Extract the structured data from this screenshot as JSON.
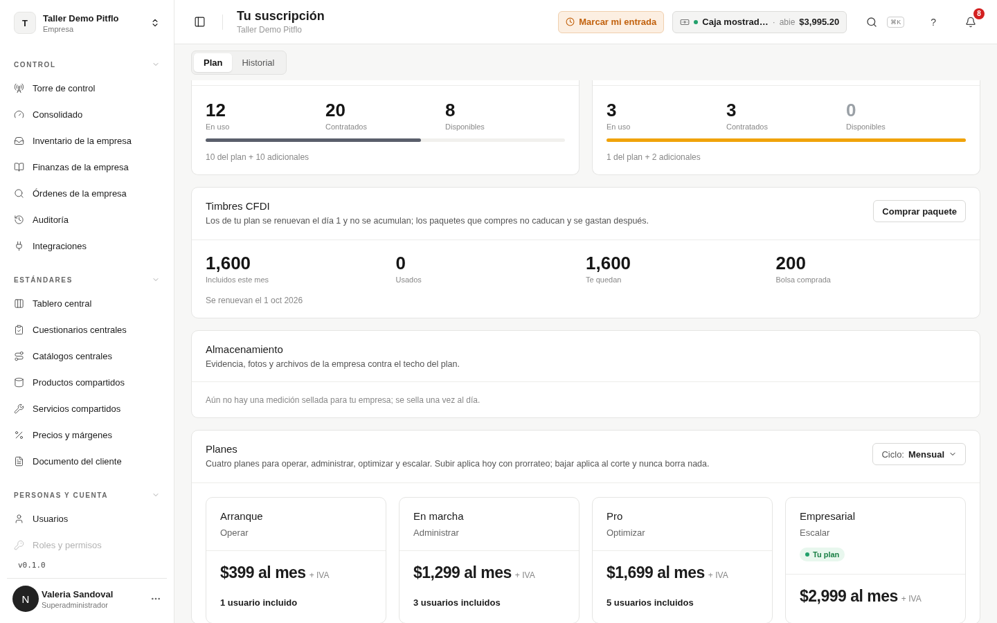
{
  "workspace": {
    "initial": "T",
    "name": "Taller Demo Pitflo",
    "type": "Empresa"
  },
  "sidebar": {
    "sections": [
      {
        "title": "CONTROL",
        "expanded": true,
        "items": [
          {
            "label": "Torre de control",
            "faded": false
          },
          {
            "label": "Consolidado",
            "faded": false
          },
          {
            "label": "Inventario de la empresa",
            "faded": false
          },
          {
            "label": "Finanzas de la empresa",
            "faded": false
          },
          {
            "label": "Órdenes de la empresa",
            "faded": false
          },
          {
            "label": "Auditoría",
            "faded": false
          },
          {
            "label": "Integraciones",
            "faded": false
          }
        ]
      },
      {
        "title": "ESTÁNDARES",
        "expanded": true,
        "items": [
          {
            "label": "Tablero central",
            "faded": false
          },
          {
            "label": "Cuestionarios centrales",
            "faded": false
          },
          {
            "label": "Catálogos centrales",
            "faded": false
          },
          {
            "label": "Productos compartidos",
            "faded": false
          },
          {
            "label": "Servicios compartidos",
            "faded": false
          },
          {
            "label": "Precios y márgenes",
            "faded": false
          },
          {
            "label": "Documento del cliente",
            "faded": false
          }
        ]
      },
      {
        "title": "PERSONAS Y CUENTA",
        "expanded": true,
        "items": [
          {
            "label": "Usuarios",
            "faded": false
          },
          {
            "label": "Roles y permisos",
            "faded": true
          }
        ]
      }
    ],
    "version": "v0.1.0"
  },
  "user": {
    "initial": "N",
    "name": "Valeria Sandoval",
    "role": "Superadministrador"
  },
  "header": {
    "title": "Tu suscripción",
    "subtitle": "Taller Demo Pitflo",
    "clock_button": "Marcar mi entrada",
    "register": {
      "name": "Caja mostrad…",
      "separator": "·",
      "status": "abie",
      "amount": "$3,995.20"
    },
    "shortcut": "⌘K",
    "help": "?",
    "notifications": "8"
  },
  "tabs": [
    {
      "label": "Plan",
      "selected": true
    },
    {
      "label": "Historial",
      "selected": false
    }
  ],
  "usage_cards": [
    {
      "stats": [
        {
          "value": "12",
          "label": "En uso",
          "muted": false
        },
        {
          "value": "20",
          "label": "Contratados",
          "muted": false
        },
        {
          "value": "8",
          "label": "Disponibles",
          "muted": false
        }
      ],
      "level": 0.6,
      "full": false,
      "note": "10 del plan + 10 adicionales"
    },
    {
      "stats": [
        {
          "value": "3",
          "label": "En uso",
          "muted": false
        },
        {
          "value": "3",
          "label": "Contratados",
          "muted": false
        },
        {
          "value": "0",
          "label": "Disponibles",
          "muted": true
        }
      ],
      "level": 1,
      "full": true,
      "note": "1 del plan + 2 adicionales"
    }
  ],
  "stamps": {
    "title": "Timbres CFDI",
    "description": "Los de tu plan se renuevan el día 1 y no se acumulan; los paquetes que compres no caducan y se gastan después.",
    "button": "Comprar paquete",
    "stats": [
      {
        "value": "1,600",
        "label": "Incluidos este mes"
      },
      {
        "value": "0",
        "label": "Usados"
      },
      {
        "value": "1,600",
        "label": "Te quedan"
      },
      {
        "value": "200",
        "label": "Bolsa comprada"
      }
    ],
    "note": "Se renuevan el 1 oct 2026"
  },
  "storage": {
    "title": "Almacenamiento",
    "description": "Evidencia, fotos y archivos de la empresa contra el techo del plan.",
    "note": "Aún no hay una medición sellada para tu empresa; se sella una vez al día."
  },
  "plans": {
    "title": "Planes",
    "description": "Cuatro planes para operar, administrar, optimizar y escalar. Subir aplica hoy con prorrateo; bajar aplica al corte y nunca borra nada.",
    "cycle_label": "Ciclo:",
    "cycle_value": "Mensual",
    "items": [
      {
        "name": "Arranque",
        "tagline": "Operar",
        "price": "$399 al mes",
        "tax": "+ IVA",
        "users": "1 usuario incluido"
      },
      {
        "name": "En marcha",
        "tagline": "Administrar",
        "price": "$1,299 al mes",
        "tax": "+ IVA",
        "users": "3 usuarios incluidos"
      },
      {
        "name": "Pro",
        "tagline": "Optimizar",
        "price": "$1,699 al mes",
        "tax": "+ IVA",
        "users": "5 usuarios incluidos"
      },
      {
        "name": "Empresarial",
        "tagline": "Escalar",
        "badge": "Tu plan",
        "price": "$2,999 al mes",
        "tax": "+ IVA"
      }
    ]
  }
}
